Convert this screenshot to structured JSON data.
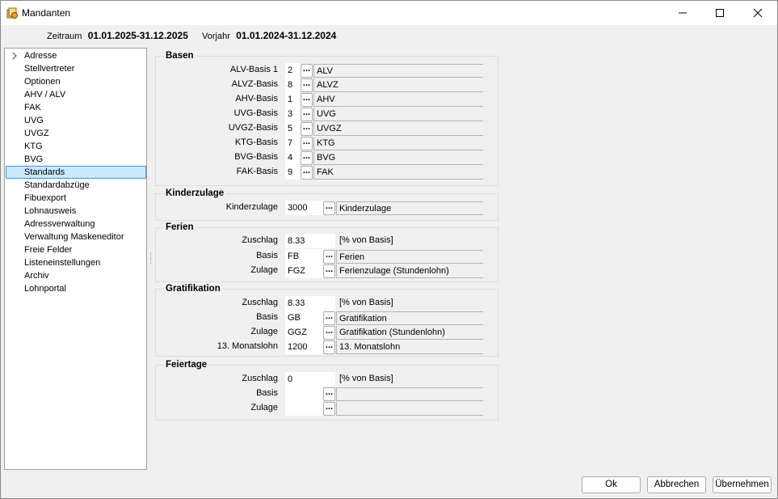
{
  "window": {
    "title": "Mandanten",
    "icons": {
      "app": "app-icon",
      "minimize": "minimize-icon",
      "maximize": "maximize-icon",
      "close": "close-icon"
    }
  },
  "header": {
    "period_label": "Zeitraum",
    "period_value": "01.01.2025-31.12.2025",
    "prev_label": "Vorjahr",
    "prev_value": "01.01.2024-31.12.2024"
  },
  "nav": {
    "items": [
      {
        "label": "Adresse"
      },
      {
        "label": "Stellvertreter"
      },
      {
        "label": "Optionen"
      },
      {
        "label": "AHV / ALV"
      },
      {
        "label": "FAK"
      },
      {
        "label": "UVG"
      },
      {
        "label": "UVGZ"
      },
      {
        "label": "KTG"
      },
      {
        "label": "BVG"
      },
      {
        "label": "Standards"
      },
      {
        "label": "Standardabzüge"
      },
      {
        "label": "Fibuexport"
      },
      {
        "label": "Lohnausweis"
      },
      {
        "label": "Adressverwaltung"
      },
      {
        "label": "Verwaltung Maskeneditor"
      },
      {
        "label": "Freie Felder"
      },
      {
        "label": "Listeneinstellungen"
      },
      {
        "label": "Archiv"
      },
      {
        "label": "Lohnportal"
      }
    ],
    "selected": "Standards",
    "selection_color": "#cce8ff",
    "selection_border": "#3c96e8"
  },
  "basen": {
    "title": "Basen",
    "rows": [
      {
        "label": "ALV-Basis 1",
        "value": "2",
        "desc": "ALV"
      },
      {
        "label": "ALVZ-Basis",
        "value": "8",
        "desc": "ALVZ"
      },
      {
        "label": "AHV-Basis",
        "value": "1",
        "desc": "AHV"
      },
      {
        "label": "UVG-Basis",
        "value": "3",
        "desc": "UVG"
      },
      {
        "label": "UVGZ-Basis",
        "value": "5",
        "desc": "UVGZ"
      },
      {
        "label": "KTG-Basis",
        "value": "7",
        "desc": "KTG"
      },
      {
        "label": "BVG-Basis",
        "value": "4",
        "desc": "BVG"
      },
      {
        "label": "FAK-Basis",
        "value": "9",
        "desc": "FAK"
      }
    ]
  },
  "kinderzulage": {
    "title": "Kinderzulage",
    "label": "Kinderzulage",
    "value": "3000",
    "desc": "Kinderzulage"
  },
  "ferien": {
    "title": "Ferien",
    "zuschlag_label": "Zuschlag",
    "zuschlag_value": "8.33",
    "zuschlag_unit": "[% von Basis]",
    "basis_label": "Basis",
    "basis_value": "FB",
    "basis_desc": "Ferien",
    "zulage_label": "Zulage",
    "zulage_value": "FGZ",
    "zulage_desc": "Ferienzulage (Stundenlohn)"
  },
  "gratifikation": {
    "title": "Gratifikation",
    "zuschlag_label": "Zuschlag",
    "zuschlag_value": "8.33",
    "zuschlag_unit": "[% von Basis]",
    "basis_label": "Basis",
    "basis_value": "GB",
    "basis_desc": "Gratifikation",
    "zulage_label": "Zulage",
    "zulage_value": "GGZ",
    "zulage_desc": "Gratifikation (Stundenlohn)",
    "monat_label": "13. Monatslohn",
    "monat_value": "1200",
    "monat_desc": "13. Monatslohn"
  },
  "feiertage": {
    "title": "Feiertage",
    "zuschlag_label": "Zuschlag",
    "zuschlag_value": "0",
    "zuschlag_unit": "[% von Basis]",
    "basis_label": "Basis",
    "basis_value": "",
    "basis_desc": "",
    "zulage_label": "Zulage",
    "zulage_value": "",
    "zulage_desc": ""
  },
  "buttons": {
    "ok": "Ok",
    "cancel": "Abbrechen",
    "apply": "Übernehmen",
    "dots": "..."
  }
}
